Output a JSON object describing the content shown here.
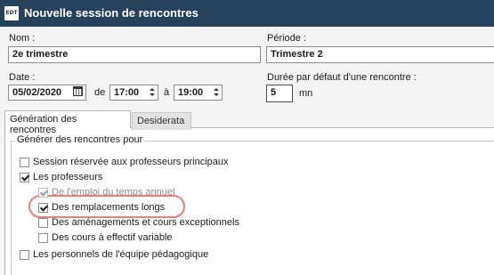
{
  "window": {
    "app_icon_text": "EDT",
    "title": "Nouvelle session de rencontres"
  },
  "form": {
    "nom_label": "Nom :",
    "nom_value": "2e trimestre",
    "periode_label": "Période :",
    "periode_value": "Trimestre 2",
    "date_label": "Date :",
    "date_value": "05/02/2020",
    "de_label": "de",
    "de_value": "17:00",
    "a_label": "à",
    "a_value": "19:00",
    "duree_label": "Durée par défaut d'une rencontre :",
    "duree_value": "5",
    "duree_unit": "mn"
  },
  "tabs": [
    {
      "label": "Génération des rencontres",
      "active": true
    },
    {
      "label": "Desiderata",
      "active": false
    }
  ],
  "group": {
    "legend": "Générer des rencontres pour",
    "options": [
      {
        "label": "Session réservée aux professeurs principaux",
        "checked": false,
        "enabled": true
      },
      {
        "label": "Les professeurs",
        "checked": true,
        "enabled": true
      },
      {
        "label": "De l'emploi du temps annuel",
        "checked": true,
        "enabled": false
      },
      {
        "label": "Des remplacements longs",
        "checked": true,
        "enabled": true,
        "highlighted": true
      },
      {
        "label": "Des aménagements et cours exceptionnels",
        "checked": false,
        "enabled": true
      },
      {
        "label": "Des cours à effectif variable",
        "checked": false,
        "enabled": true
      },
      {
        "label": "Les personnels de l'équipe pédagogique",
        "checked": false,
        "enabled": true
      }
    ]
  },
  "colors": {
    "titlebar": "#26415c",
    "highlight": "#ee7f77"
  }
}
